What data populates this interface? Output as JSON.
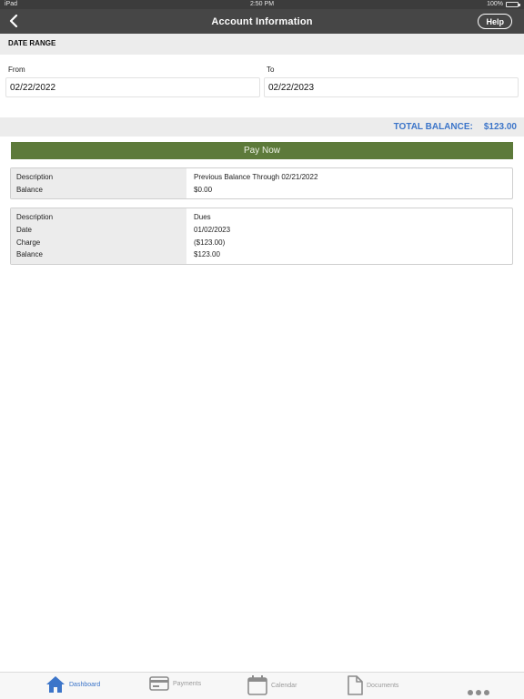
{
  "status_bar": {
    "carrier": "iPad",
    "time": "2:50 PM",
    "battery": "100%"
  },
  "nav": {
    "title": "Account Information",
    "help_label": "Help"
  },
  "date_range": {
    "header": "DATE RANGE",
    "from_label": "From",
    "from_value": "02/22/2022",
    "to_label": "To",
    "to_value": "02/22/2023"
  },
  "total": {
    "label": "TOTAL BALANCE:",
    "value": "$123.00"
  },
  "pay_now_label": "Pay Now",
  "transactions": [
    {
      "keys": [
        "Description",
        "Balance"
      ],
      "values": [
        "Previous Balance Through 02/21/2022",
        "$0.00"
      ]
    },
    {
      "keys": [
        "Description",
        "Date",
        "Charge",
        "Balance"
      ],
      "values": [
        "Dues",
        "01/02/2023",
        "($123.00)",
        "$123.00"
      ]
    }
  ],
  "tabs": [
    {
      "label": "Dashboard",
      "icon": "home-icon",
      "active": true
    },
    {
      "label": "Payments",
      "icon": "card-icon",
      "active": false
    },
    {
      "label": "Calendar",
      "icon": "calendar-icon",
      "active": false
    },
    {
      "label": "Documents",
      "icon": "document-icon",
      "active": false
    }
  ],
  "colors": {
    "accent": "#3c75c9",
    "pay_button": "#5d7a3a",
    "nav_bar": "#464646"
  }
}
